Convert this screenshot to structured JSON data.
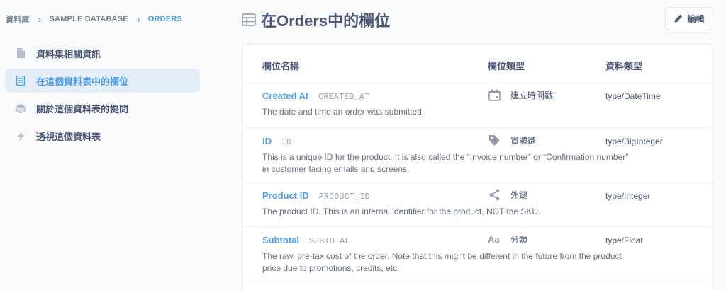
{
  "breadcrumb": {
    "items": [
      "資料庫",
      "SAMPLE DATABASE",
      "ORDERS"
    ],
    "separator": "›"
  },
  "sidebar": {
    "items": [
      {
        "label": "資料集相關資訊",
        "icon": "document-icon"
      },
      {
        "label": "在這個資料表中的欄位",
        "icon": "field-list-icon",
        "active": true
      },
      {
        "label": "關於這個資料表的提問",
        "icon": "layers-icon"
      },
      {
        "label": "透視這個資料表",
        "icon": "bolt-icon"
      }
    ]
  },
  "header": {
    "title": "在Orders中的欄位",
    "icon": "table-icon",
    "edit_label": "編輯"
  },
  "table": {
    "columns": [
      "欄位名稱",
      "欄位類型",
      "資料類型"
    ],
    "rows": [
      {
        "display_name": "Created At",
        "db_name": "CREATED_AT",
        "semantic_type": "建立時間戳",
        "semantic_icon": "calendar-icon",
        "data_type": "type/DateTime",
        "description": "The date and time an order was submitted."
      },
      {
        "display_name": "ID",
        "db_name": "ID",
        "semantic_type": "實體鍵",
        "semantic_icon": "tag-icon",
        "data_type": "type/BigInteger",
        "description_lines": [
          "This is a unique ID for the product. It is also called the “Invoice number” or “Confirmation number”",
          "in customer facing emails and screens."
        ]
      },
      {
        "display_name": "Product ID",
        "db_name": "PRODUCT_ID",
        "semantic_type": "外鍵",
        "semantic_icon": "share-icon",
        "data_type": "type/Integer",
        "description": "The product ID. This is an internal identifier for the product, NOT the SKU."
      },
      {
        "display_name": "Subtotal",
        "db_name": "SUBTOTAL",
        "semantic_type": "分類",
        "semantic_icon": "text-aa-icon",
        "data_type": "type/Float",
        "description_lines": [
          "The raw, pre-tax cost of the order. Note that this might be different in the future from the product",
          "price due to promotions, credits, etc."
        ]
      }
    ]
  },
  "colors": {
    "accent": "#509ee3",
    "text": "#4c5773",
    "muted": "#949aab",
    "active_bg": "#e3eef9"
  }
}
